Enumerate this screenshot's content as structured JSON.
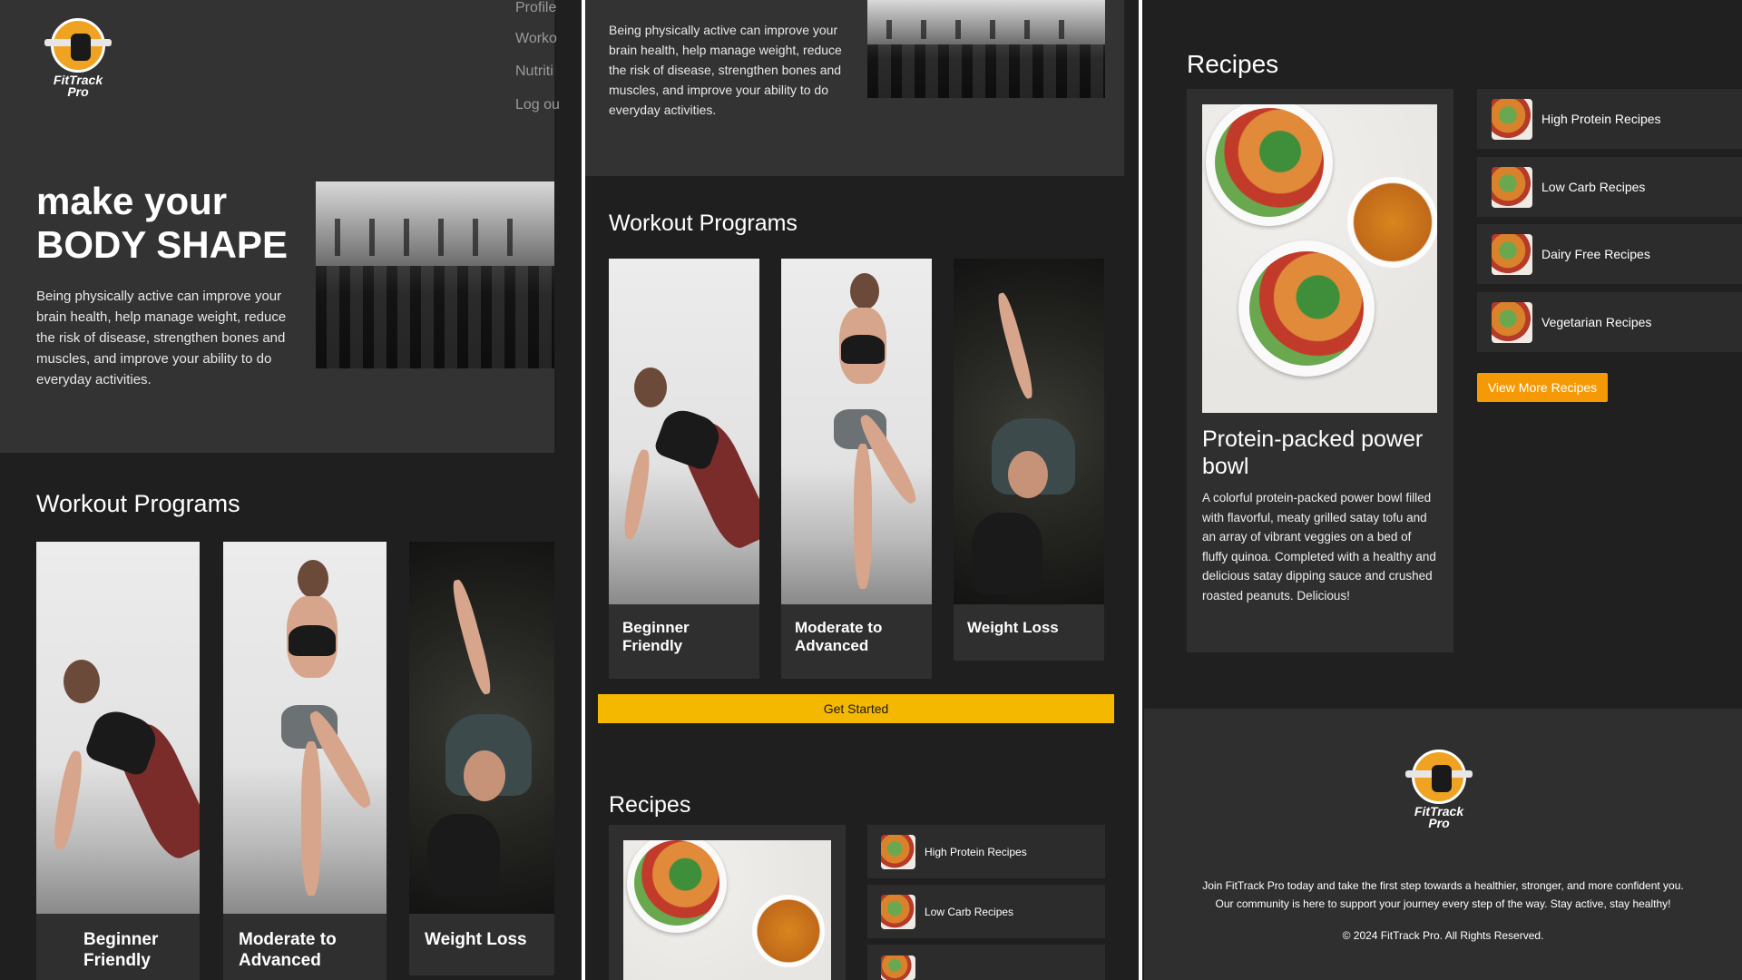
{
  "brand": {
    "name_line1": "FitTrack",
    "name_line2": "Pro",
    "accent": "#f5b800"
  },
  "nav": [
    "Profile",
    "Worko",
    "Nutriti",
    "Log ou"
  ],
  "hero": {
    "title_line1": "make your",
    "title_line2": "BODY SHAPE",
    "text": "Being physically active can improve your brain health, help manage weight, reduce the risk of disease, strengthen bones and muscles, and improve your ability to do everyday activities."
  },
  "workouts": {
    "heading": "Workout Programs",
    "cards": [
      {
        "label_line1": "Beginner",
        "label_line2": "Friendly"
      },
      {
        "label_line1": "Moderate to",
        "label_line2": "Advanced"
      },
      {
        "label_line1": "Weight Loss",
        "label_line2": ""
      }
    ],
    "cta": "Get Started"
  },
  "recipes": {
    "heading": "Recipes",
    "featured": {
      "title": "Protein-packed power bowl",
      "text": "A colorful protein-packed power bowl filled with flavorful, meaty grilled satay tofu and an array of vibrant veggies on a bed of fluffy quinoa. Completed with a healthy and delicious satay dipping sauce and crushed roasted peanuts. Delicious!"
    },
    "categories": [
      "High Protein Recipes",
      "Low Carb Recipes",
      "Dairy Free Recipes",
      "Vegetarian Recipes"
    ],
    "more_button": "View More Recipes"
  },
  "footer": {
    "line1": "Join FitTrack Pro today and take the first step towards a healthier, stronger, and more confident you.",
    "line2": "Our community is here to support your journey every step of the way. Stay active, stay healthy!",
    "copyright": "© 2024 FitTrack Pro. All Rights Reserved."
  }
}
